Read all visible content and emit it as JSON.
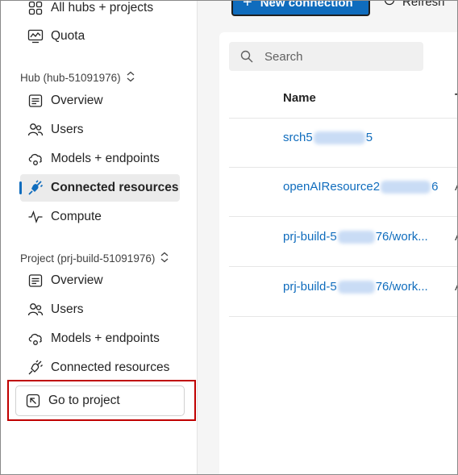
{
  "sidebar": {
    "top_item": "All hubs + projects",
    "quota": "Quota",
    "hub_section": "Hub (hub-51091976)",
    "hub_items": [
      {
        "label": "Overview",
        "icon": "overview-icon"
      },
      {
        "label": "Users",
        "icon": "users-icon"
      },
      {
        "label": "Models + endpoints",
        "icon": "models-icon"
      },
      {
        "label": "Connected resources",
        "icon": "plug-icon",
        "active": true
      },
      {
        "label": "Compute",
        "icon": "compute-icon"
      }
    ],
    "project_section": "Project (prj-build-51091976)",
    "project_items": [
      {
        "label": "Overview",
        "icon": "overview-icon"
      },
      {
        "label": "Users",
        "icon": "users-icon"
      },
      {
        "label": "Models + endpoints",
        "icon": "models-icon"
      },
      {
        "label": "Connected resources",
        "icon": "plug-icon"
      }
    ],
    "goto_project": "Go to project"
  },
  "toolbar": {
    "new_connection": "New connection",
    "refresh": "Refresh"
  },
  "table": {
    "search_placeholder": "Search",
    "column_name": "Name",
    "column_second": "T",
    "rows": [
      {
        "name_start": "srch5",
        "name_end": "5",
        "type": ""
      },
      {
        "name_start": "openAIResource2",
        "name_end": "6",
        "type": "A"
      },
      {
        "name_start": "prj-build-5",
        "name_end": "76/work...",
        "type": "A"
      },
      {
        "name_start": "prj-build-5",
        "name_end": "76/work...",
        "type": "A"
      }
    ]
  },
  "colors": {
    "accent": "#0f6cbd",
    "highlight": "#c00000"
  }
}
